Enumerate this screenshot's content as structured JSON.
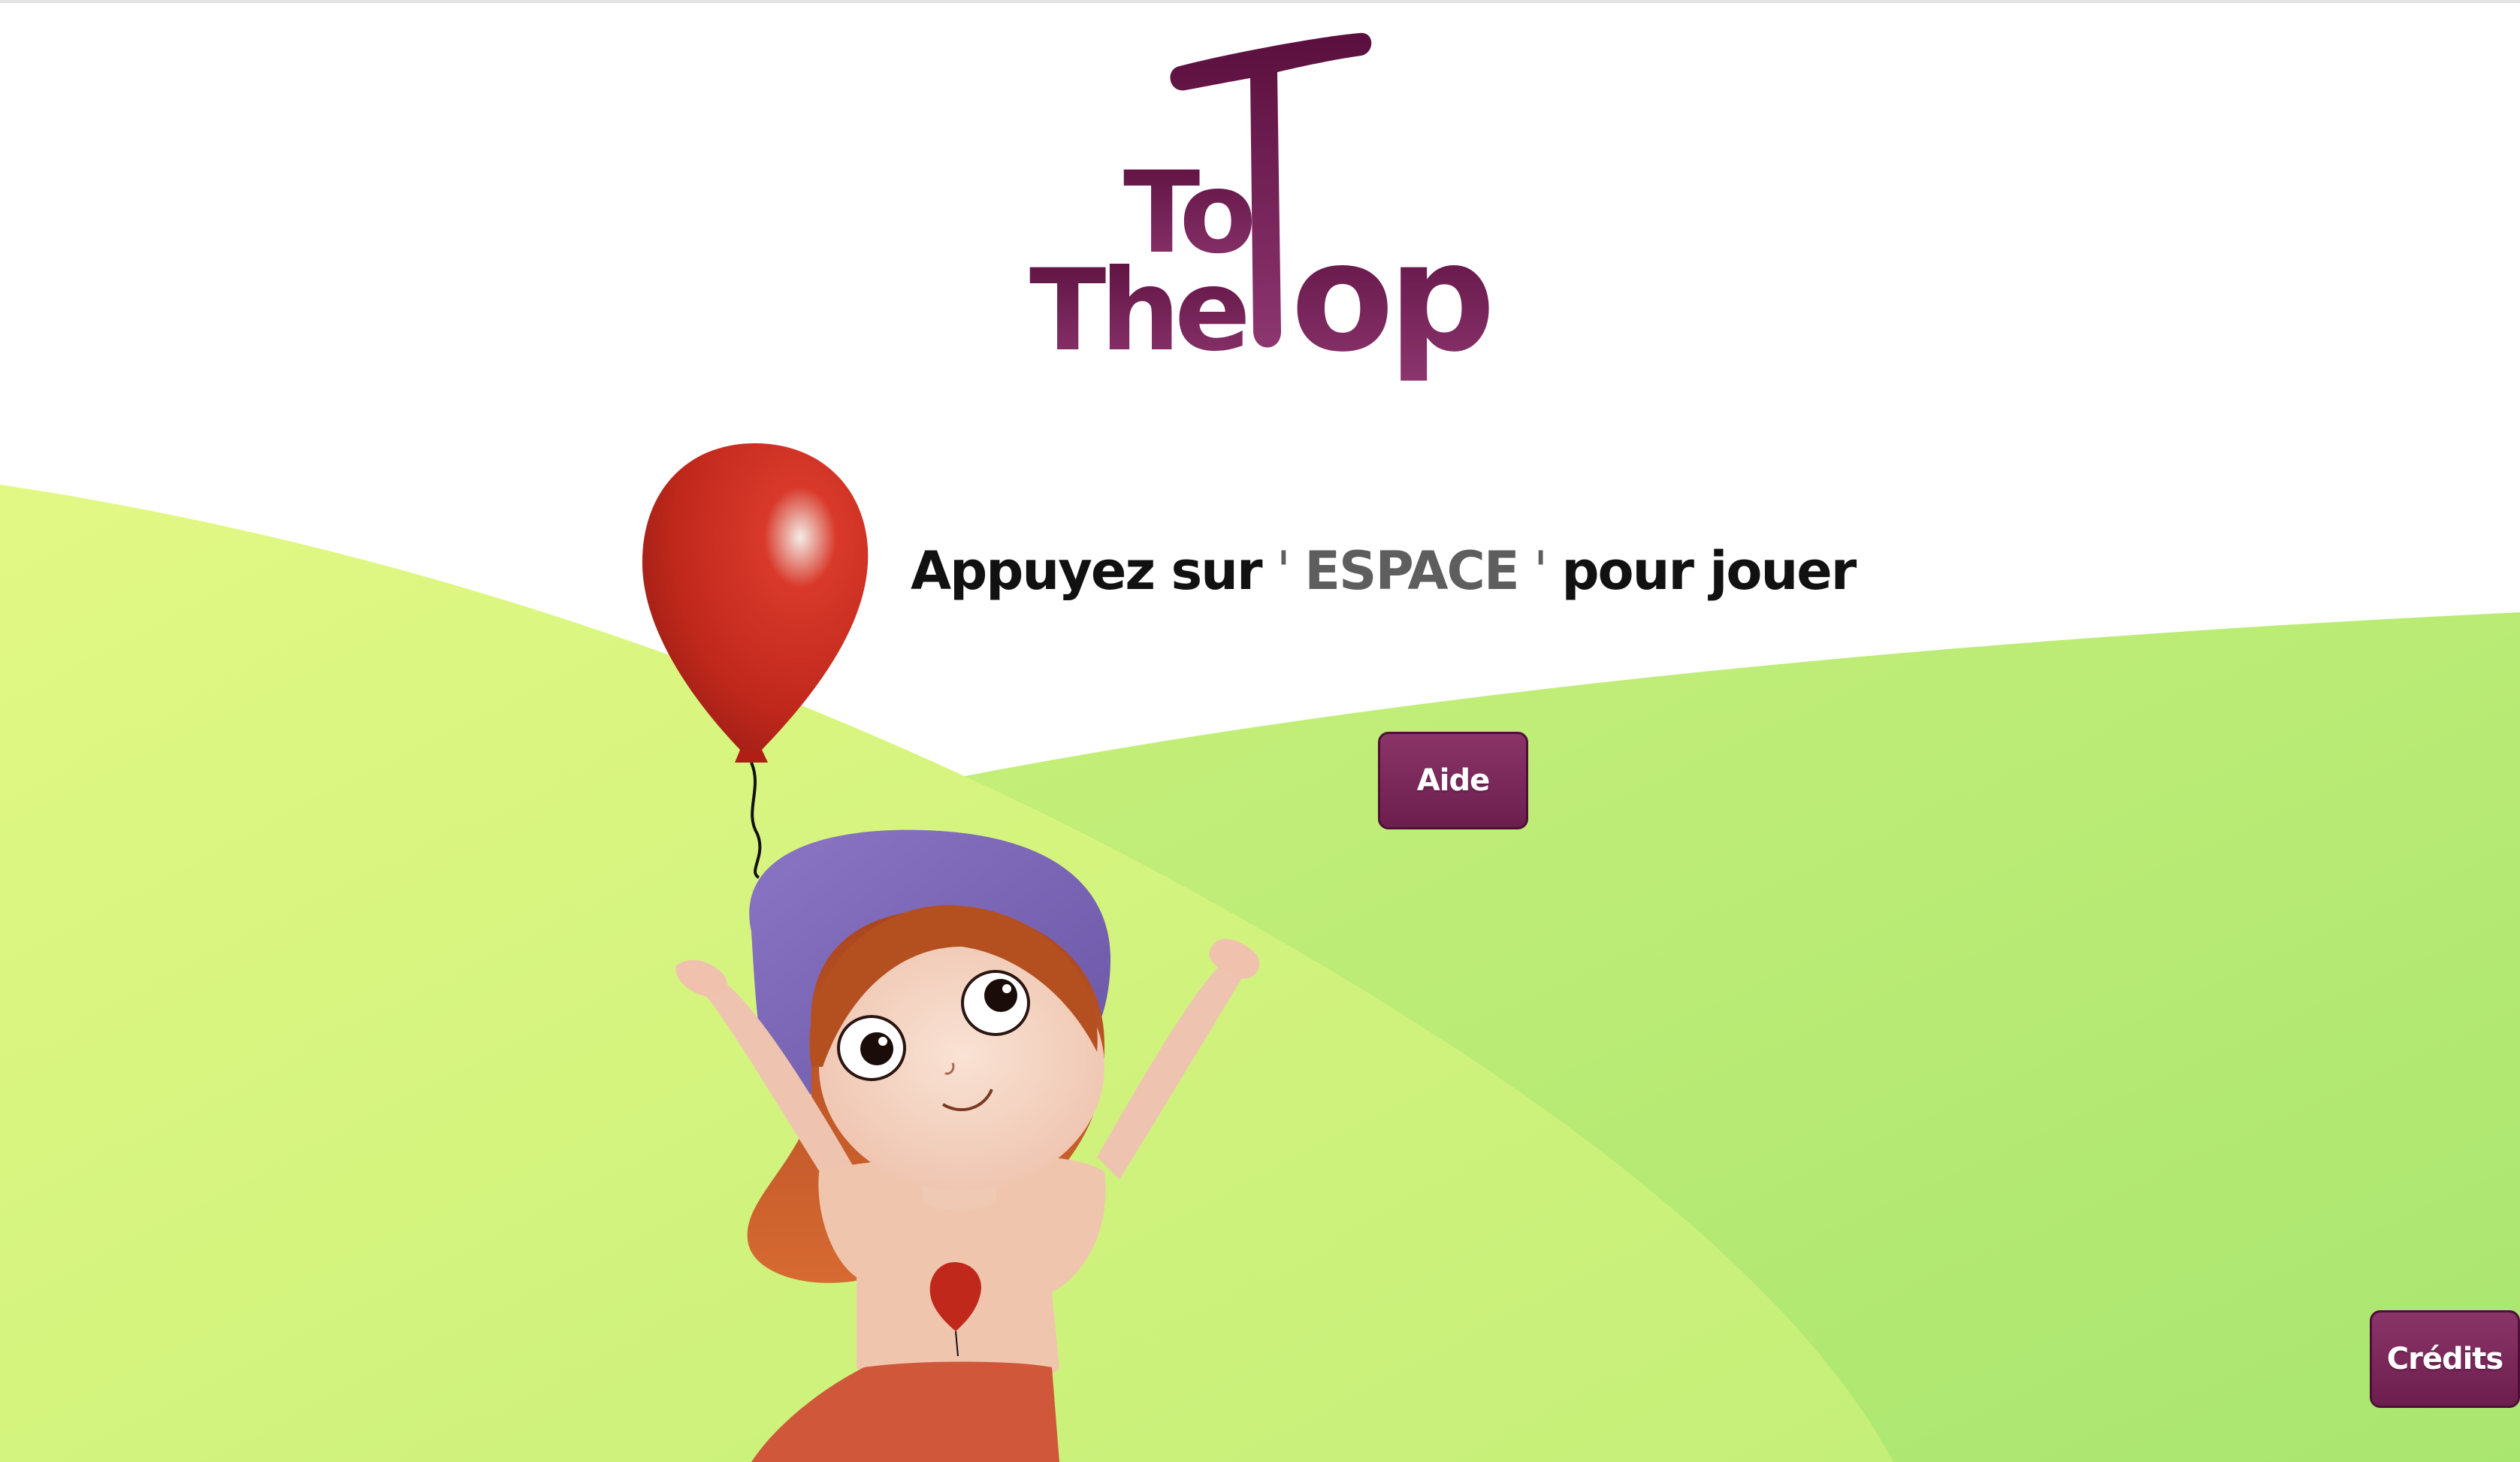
{
  "logo": {
    "word_the": "The",
    "word_to": "To",
    "word_top_t": "T",
    "word_top_rest": "op"
  },
  "prompt": {
    "before": "Appuyez sur",
    "quote_open": " ' ",
    "key": "ESPACE",
    "quote_close": " ' ",
    "after": "pour jouer"
  },
  "buttons": {
    "help_label": "Aide",
    "credits_label": "Crédits"
  },
  "colors": {
    "brand": "#6c1e4e",
    "grass_light": "#dcf57e",
    "grass_mid": "#b9ec76",
    "balloon": "#c0281c",
    "hat": "#7b67b6",
    "hair": "#c4572a"
  },
  "icons": {
    "balloon": "balloon-icon",
    "character": "girl-character"
  }
}
